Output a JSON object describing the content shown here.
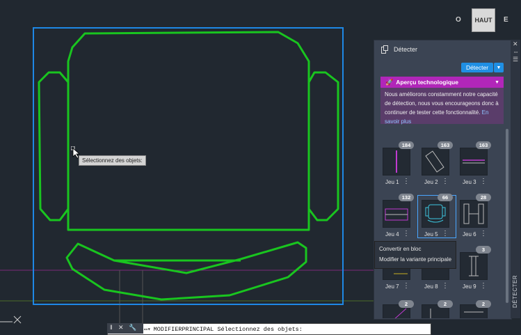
{
  "viewcube": {
    "top_label": "HAUT",
    "west": "O",
    "east": "E"
  },
  "tooltip": {
    "text": "Sélectionnez des objets:"
  },
  "panel": {
    "title": "Détecter",
    "detect_button": "Détecter",
    "preview": {
      "title": "Aperçu technologique",
      "line1": "Nous améliorons constamment notre capacité",
      "line2": "de détection, nous vous encourageons donc à",
      "line3a": "continuer de tester cette fonctionnalité.",
      "line3b": "En",
      "line4": "savoir plus"
    },
    "vertical_label": "DÉTECTER",
    "sets": [
      {
        "label": "Jeu 1",
        "count": "184"
      },
      {
        "label": "Jeu 2",
        "count": "163"
      },
      {
        "label": "Jeu 3",
        "count": "163"
      },
      {
        "label": "Jeu 4",
        "count": "132"
      },
      {
        "label": "Jeu 5",
        "count": "66"
      },
      {
        "label": "Jeu 6",
        "count": "28"
      },
      {
        "label": "Jeu 7",
        "count": ""
      },
      {
        "label": "Jeu 8",
        "count": ""
      },
      {
        "label": "Jeu 9",
        "count": "3"
      },
      {
        "label": "",
        "count": "2"
      },
      {
        "label": "",
        "count": "2"
      },
      {
        "label": "",
        "count": "2"
      }
    ],
    "context_menu": [
      "Convertir en bloc",
      "Modifier la variante principale"
    ]
  },
  "command_line": {
    "text": "MODIFIERPRINCIPAL Sélectionnez des objets:"
  },
  "colors": {
    "accent": "#1f8fe3",
    "preview": "#b126b9",
    "geometry": "#19c51f",
    "selection": "#1e88e5"
  }
}
